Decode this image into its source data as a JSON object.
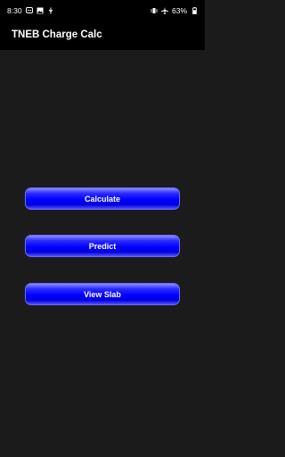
{
  "status_bar": {
    "time": "8:30",
    "battery": "63%",
    "left_icons": [
      "message-icon",
      "image-icon",
      "usb-icon"
    ],
    "right_icons": [
      "vibrate-icon",
      "airplane-icon",
      "battery-icon"
    ]
  },
  "app_bar": {
    "title": "TNEB Charge Calc"
  },
  "buttons": {
    "calculate": "Calculate",
    "predict": "Predict",
    "view_slab": "View Slab"
  },
  "colors": {
    "button_blue": "#0000ff",
    "background": "#1b1b1b",
    "app_bar": "#000000"
  }
}
